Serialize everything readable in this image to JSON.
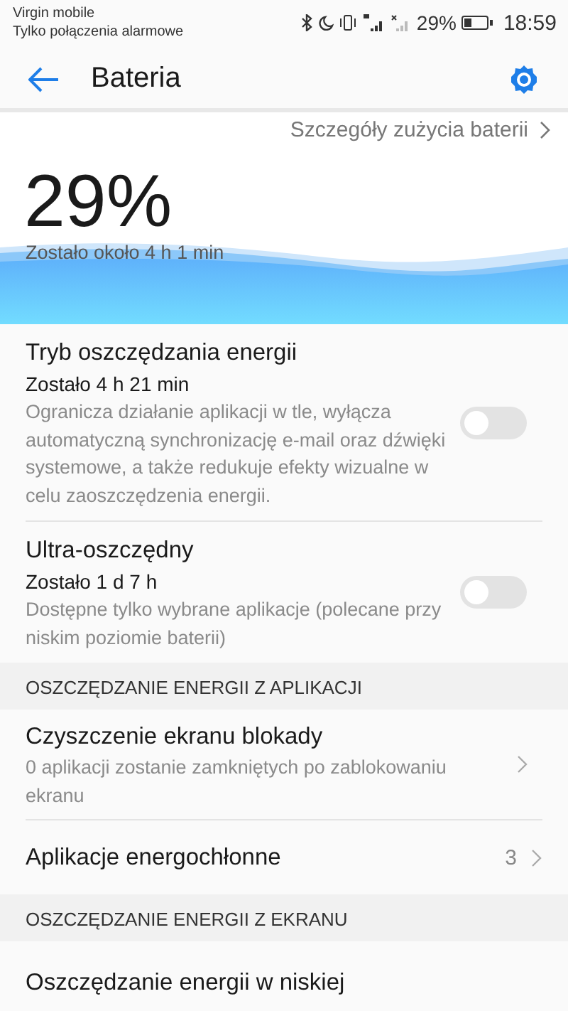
{
  "status_bar": {
    "carrier": "Virgin mobile",
    "carrier_note": "Tylko połączenia alarmowe",
    "battery_percent": "29%",
    "time": "18:59"
  },
  "header": {
    "title": "Bateria"
  },
  "details_link": "Szczegóły zużycia baterii",
  "battery": {
    "percent": "29%",
    "remaining": "Zostało około 4 h 1 min"
  },
  "sections": [
    {
      "items": [
        {
          "kind": "toggle",
          "title": "Tryb oszczędzania energii",
          "subtitle": "Zostało 4 h 21 min",
          "description": "Ogranicza działanie aplikacji w tle, wyłącza automatyczną synchronizację e-mail oraz dźwięki systemowe, a także redukuje efekty wizualne w celu zaoszczędzenia energii.",
          "on": false
        },
        {
          "kind": "toggle",
          "title": "Ultra-oszczędny",
          "subtitle": "Zostało 1 d 7 h",
          "description": "Dostępne tylko wybrane aplikacje (polecane przy niskim poziomie baterii)",
          "on": false
        }
      ]
    },
    {
      "heading": "OSZCZĘDZANIE ENERGII Z APLIKACJI",
      "items": [
        {
          "kind": "nav",
          "title": "Czyszczenie ekranu blokady",
          "description": "0 aplikacji zostanie zamkniętych po zablokowaniu ekranu"
        },
        {
          "kind": "nav",
          "title": "Aplikacje energochłonne",
          "value": "3"
        }
      ]
    },
    {
      "heading": "OSZCZĘDZANIE ENERGII Z EKRANU",
      "items": [
        {
          "kind": "plain",
          "title": "Oszczędzanie energii w niskiej"
        }
      ]
    }
  ]
}
